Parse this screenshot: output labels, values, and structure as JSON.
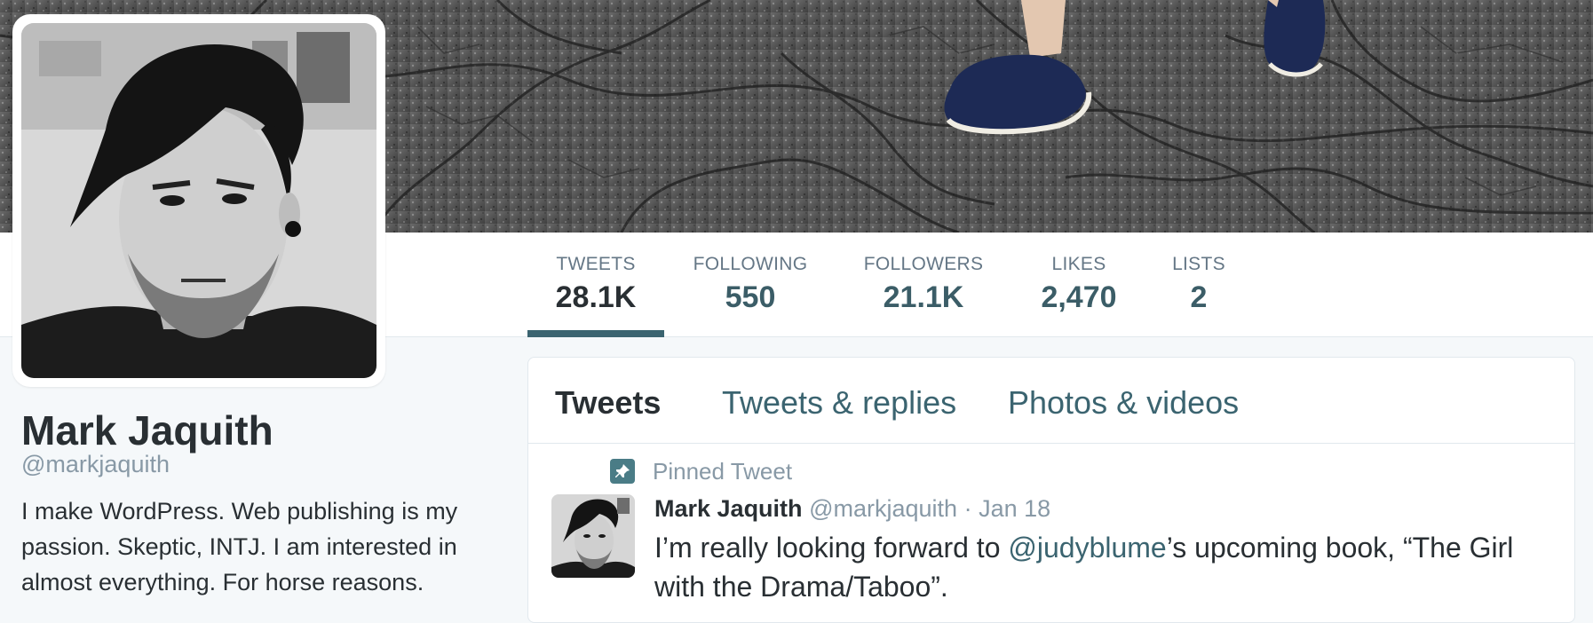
{
  "profile": {
    "name": "Mark Jaquith",
    "handle": "@markjaquith",
    "bio": "I make WordPress. Web publishing is my passion. Skeptic, INTJ. I am interested in almost everything. For horse reasons."
  },
  "stats": [
    {
      "label": "TWEETS",
      "value": "28.1K",
      "active": true
    },
    {
      "label": "FOLLOWING",
      "value": "550",
      "active": false
    },
    {
      "label": "FOLLOWERS",
      "value": "21.1K",
      "active": false
    },
    {
      "label": "LIKES",
      "value": "2,470",
      "active": false
    },
    {
      "label": "LISTS",
      "value": "2",
      "active": false
    }
  ],
  "tabs": [
    {
      "label": "Tweets",
      "active": true
    },
    {
      "label": "Tweets & replies",
      "active": false
    },
    {
      "label": "Photos & videos",
      "active": false
    }
  ],
  "tweet": {
    "pinned_label": "Pinned Tweet",
    "author_name": "Mark Jaquith",
    "author_handle": "@markjaquith",
    "separator": "·",
    "date": "Jan 18",
    "text_before": "I’m really looking forward to ",
    "mention": "@judyblume",
    "text_after": "’s upcoming book, “The Girl with the Drama/Taboo”."
  },
  "icons": {
    "pin": "pin-icon",
    "avatar": "avatar",
    "banner": "header-banner"
  },
  "colors": {
    "accent": "#3b6470",
    "text": "#292f33",
    "muted": "#8899a6",
    "background": "#f5f8fa"
  }
}
